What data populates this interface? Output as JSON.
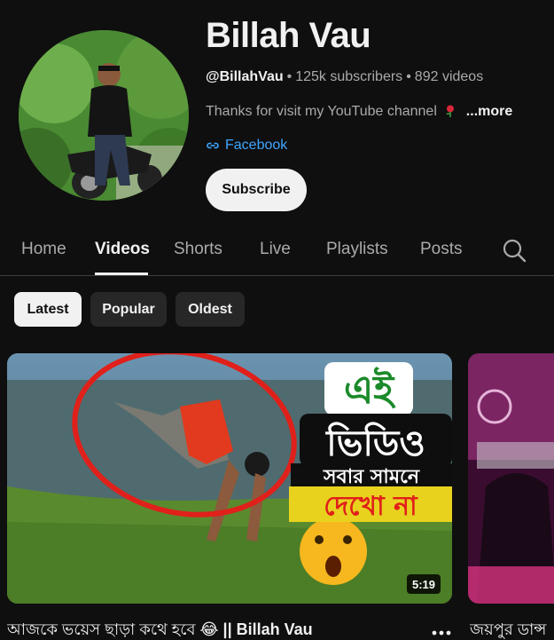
{
  "channel": {
    "name": "Billah Vau",
    "handle": "@BillahVau",
    "subscribers": "125k subscribers",
    "videos": "892 videos",
    "separator": "•",
    "description": "Thanks for visit my YouTube channel",
    "more_label": "...more",
    "link_label": "Facebook",
    "subscribe_label": "Subscribe"
  },
  "tabs": [
    {
      "label": "Home"
    },
    {
      "label": "Videos",
      "active": true
    },
    {
      "label": "Shorts"
    },
    {
      "label": "Live"
    },
    {
      "label": "Playlists"
    },
    {
      "label": "Posts"
    }
  ],
  "filters": [
    {
      "label": "Latest",
      "active": true
    },
    {
      "label": "Popular"
    },
    {
      "label": "Oldest"
    }
  ],
  "videos": [
    {
      "title_text": "আজকে ভয়েস ছাড়া কথে হবে",
      "title_emoji": "😂",
      "title_suffix": "|| Billah Vau",
      "duration": "5:19",
      "thumb_text_1": "এই",
      "thumb_text_2": "ভিডিও",
      "thumb_text_3": "সবার সামনে",
      "thumb_text_4": "দেখো না"
    },
    {
      "title_text": "জয়পুর ডান্স"
    }
  ],
  "colors": {
    "background": "#0f0f0f",
    "text_primary": "#f1f1f1",
    "text_secondary": "#aaaaaa",
    "link": "#3ea6ff",
    "chip_bg": "#272727"
  },
  "icons": {
    "link": "link-icon",
    "search": "search-icon",
    "more": "more-vert-icon",
    "rose": "rose-icon"
  }
}
